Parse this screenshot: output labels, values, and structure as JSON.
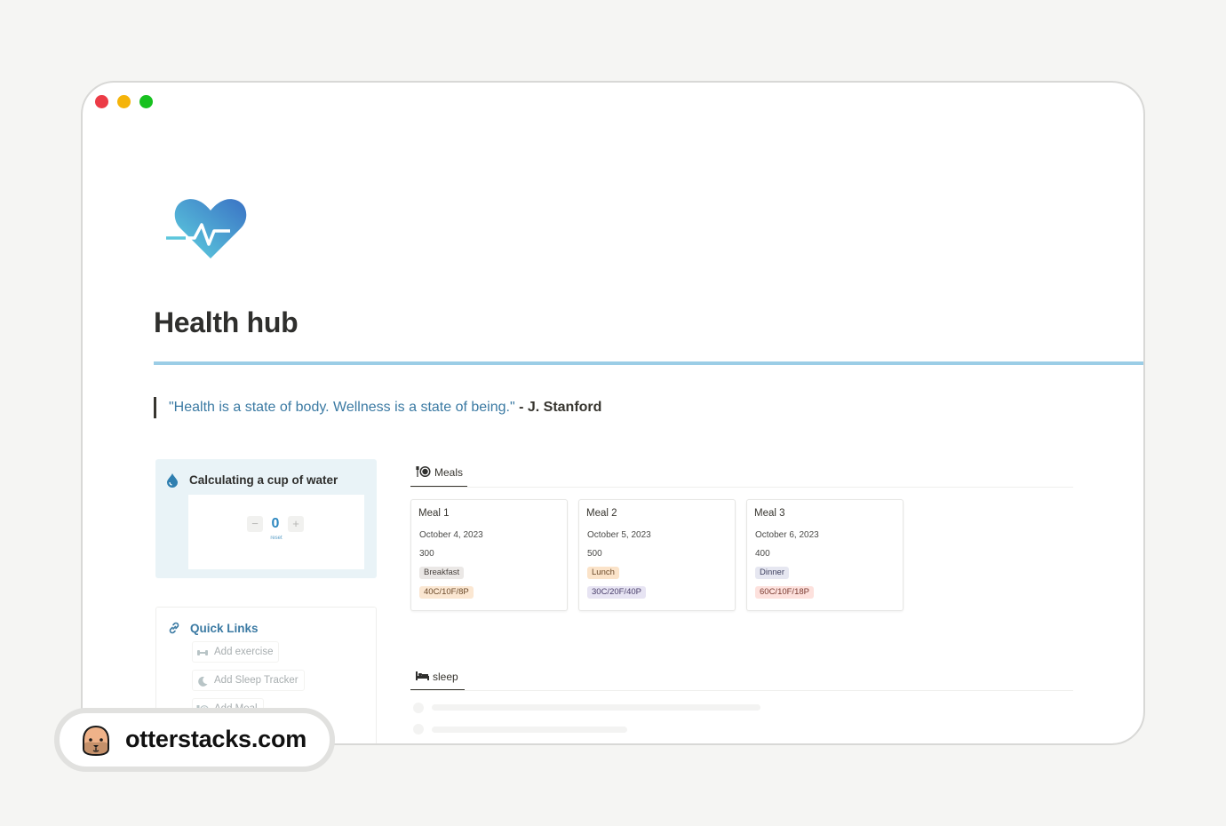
{
  "window": {
    "controls": [
      "close",
      "minimize",
      "maximize"
    ]
  },
  "page": {
    "icon": "heartbeat-icon",
    "title": "Health hub",
    "accent_color": "#9bcde6",
    "quote": {
      "text": "\"Health is a state of body. Wellness is a state of being.\"",
      "author": " - J. Stanford",
      "text_color": "#3b7aa3"
    }
  },
  "water": {
    "icon": "water-drop-icon",
    "title": "Calculating a cup of water",
    "counter_value": "0",
    "decrement_label": "−",
    "increment_label": "+",
    "reset_label": "reset"
  },
  "quick_links": {
    "icon": "link-icon",
    "title": "Quick Links",
    "items": [
      {
        "icon": "dumbbell-icon",
        "label": "Add exercise"
      },
      {
        "icon": "moon-icon",
        "label": "Add Sleep Tracker"
      },
      {
        "icon": "fork-plate-icon",
        "label": "Add Meal"
      }
    ]
  },
  "meals": {
    "tab_icon": "fork-plate-icon",
    "tab_label": "Meals",
    "cards": [
      {
        "name": "Meal 1",
        "date": "October 4, 2023",
        "calories": "300",
        "type": "Breakfast",
        "type_bg": "#ebe8e6",
        "type_color": "#4a4440",
        "macros": "40C/10F/8P",
        "macros_bg": "#fbe7d2",
        "macros_color": "#6b4a2a"
      },
      {
        "name": "Meal 2",
        "date": "October 5, 2023",
        "calories": "500",
        "type": "Lunch",
        "type_bg": "#fbe3c9",
        "type_color": "#6b4a2a",
        "macros": "30C/20F/40P",
        "macros_bg": "#e7e4f3",
        "macros_color": "#4a3f6b"
      },
      {
        "name": "Meal 3",
        "date": "October 6, 2023",
        "calories": "400",
        "type": "Dinner",
        "type_bg": "#e6e7f1",
        "type_color": "#3e4160",
        "macros": "60C/10F/18P",
        "macros_bg": "#fde1dd",
        "macros_color": "#7a3a30"
      }
    ]
  },
  "sleep": {
    "tab_icon": "bed-icon",
    "tab_label": "sleep"
  },
  "watermark": {
    "avatar": "otter-avatar-icon",
    "text": "otterstacks.com"
  }
}
